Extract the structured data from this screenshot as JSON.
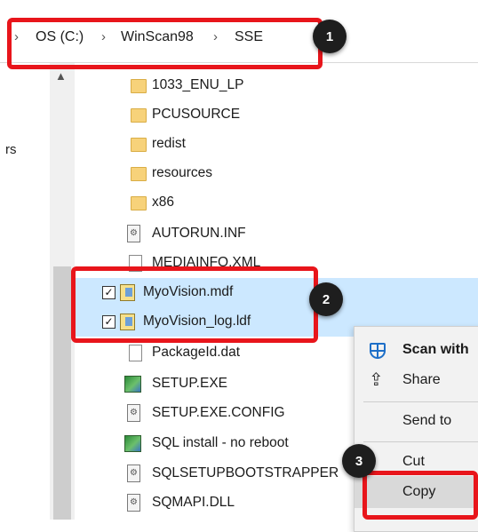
{
  "address_bar": {
    "nav_chevron": "›",
    "breadcrumb": [
      "OS (C:)",
      "WinScan98",
      "SSE"
    ],
    "separator": "›"
  },
  "left_pane": {
    "partial_label": "rs"
  },
  "files": [
    {
      "name": "1033_ENU_LP",
      "type": "folder",
      "selected": false
    },
    {
      "name": "PCUSOURCE",
      "type": "folder",
      "selected": false
    },
    {
      "name": "redist",
      "type": "folder",
      "selected": false
    },
    {
      "name": "resources",
      "type": "folder",
      "selected": false
    },
    {
      "name": "x86",
      "type": "folder",
      "selected": false
    },
    {
      "name": "AUTORUN.INF",
      "type": "settings-file",
      "selected": false
    },
    {
      "name": "MEDIAINFO.XML",
      "type": "file",
      "selected": false
    },
    {
      "name": "MyoVision.mdf",
      "type": "database",
      "selected": true
    },
    {
      "name": "MyoVision_log.ldf",
      "type": "database",
      "selected": true
    },
    {
      "name": "PackageId.dat",
      "type": "file",
      "selected": false
    },
    {
      "name": "SETUP.EXE",
      "type": "exe",
      "selected": false
    },
    {
      "name": "SETUP.EXE.CONFIG",
      "type": "config",
      "selected": false
    },
    {
      "name": "SQL install - no reboot",
      "type": "exe",
      "selected": false
    },
    {
      "name": "SQLSETUPBOOTSTRAPPER",
      "type": "settings-file",
      "selected": false
    },
    {
      "name": "SQMAPI.DLL",
      "type": "settings-file",
      "selected": false
    }
  ],
  "context_menu": {
    "items": [
      "Scan with",
      "Share",
      "Send to",
      "Cut",
      "Copy"
    ],
    "icons": [
      "defender-shield-icon",
      "share-icon"
    ]
  },
  "callouts": [
    "1",
    "2",
    "3"
  ],
  "colors": {
    "highlight": "#e8151b",
    "selection": "#cce8ff",
    "callout": "#1e1e1e"
  }
}
